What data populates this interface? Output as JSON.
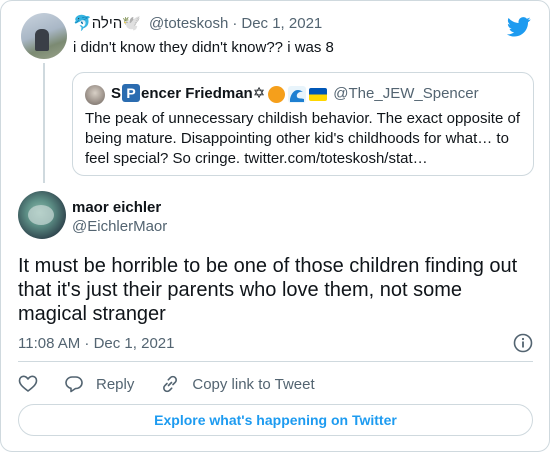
{
  "parent_tweet": {
    "display_name": "🐬הילה🕊️",
    "handle": "@toteskosh",
    "separator": "·",
    "date": "Dec 1, 2021",
    "text": "i didn't know they didn't know?? i was 8"
  },
  "quoted_tweet": {
    "name_prefix": "S",
    "name_badge": "P",
    "name_suffix": "encer Friedman✡",
    "handle": "@The_JEW_Spencer",
    "text": "The peak of unnecessary childish behavior. The exact opposite of being mature. Disappointing other kid's childhoods for what… to feel special? So cringe. twitter.com/toteskosh/stat…"
  },
  "main_tweet": {
    "display_name": "maor eichler",
    "handle": "@EichlerMaor",
    "text": "It must be horrible to be one of those children finding out that it's just their parents who love them, not some magical stranger",
    "time": "11:08 AM · Dec 1, 2021"
  },
  "actions": {
    "like_icon": "heart-icon",
    "reply_label": "Reply",
    "reply_icon": "speech-bubble-icon",
    "copy_label": "Copy link to Tweet",
    "copy_icon": "link-icon"
  },
  "explore_label": "Explore what's happening on Twitter",
  "colors": {
    "accent": "#1d9bf0",
    "secondary_text": "#536471",
    "border": "#cfd9de"
  }
}
